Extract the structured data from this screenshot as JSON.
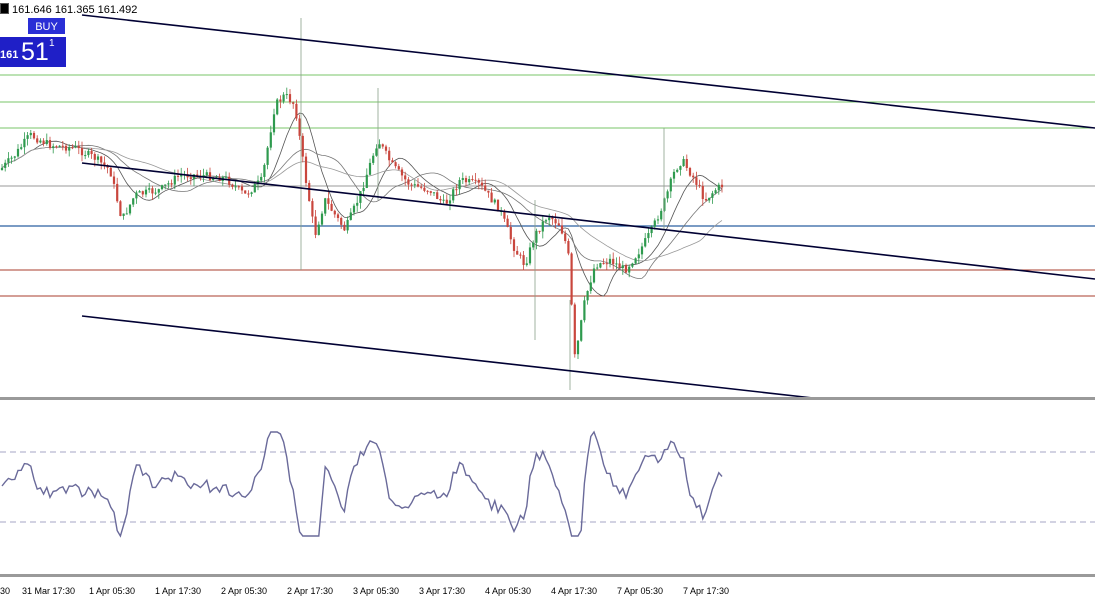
{
  "header": {
    "ohlc_text": "161.646 161.365 161.492"
  },
  "one_click_trading": {
    "buy_label": "BUY",
    "price_prefix": "161",
    "price_big": "51",
    "price_sup": "1"
  },
  "x_axis": {
    "labels": [
      "30",
      "31 Mar 17:30",
      "1 Apr 05:30",
      "1 Apr 17:30",
      "2 Apr 05:30",
      "2 Apr 17:30",
      "3 Apr 05:30",
      "3 Apr 17:30",
      "4 Apr 05:30",
      "4 Apr 17:30",
      "7 Apr 05:30",
      "7 Apr 17:30"
    ]
  },
  "colors": {
    "resistance_lines": "#7ac46a",
    "pivot_line": "#2a5fa0",
    "support_lines": "#a83c2c",
    "candle_up": "#2e9a4e",
    "candle_down": "#c9463d",
    "oscillator": "#6a6a9a",
    "trend_lines": "#000033"
  }
}
